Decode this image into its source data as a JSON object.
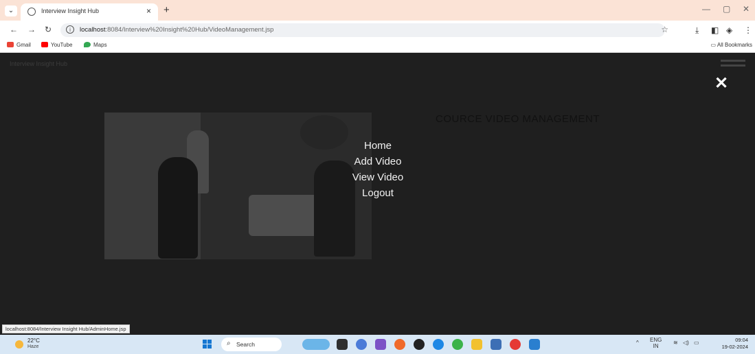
{
  "browser": {
    "tab_title": "Interview Insight Hub",
    "tab_close": "×",
    "new_tab": "+",
    "url_host": "localhost",
    "url_path": ":8084/Interview%20Insight%20Hub/VideoManagement.jsp",
    "window_minimize": "—",
    "window_restore": "▢",
    "window_close": "✕"
  },
  "bookmarks": [
    {
      "label": "Gmail",
      "color": "#ea4335"
    },
    {
      "label": "YouTube",
      "color": "#ff0000"
    },
    {
      "label": "Maps",
      "color": "#34a853"
    }
  ],
  "all_bookmarks": "All Bookmarks",
  "page": {
    "site_title": "Interview Insight Hub",
    "heading": "COURCE VIDEO MANAGEMENT",
    "close_symbol": "✕",
    "menu": [
      {
        "label": "Home"
      },
      {
        "label": "Add Video"
      },
      {
        "label": "View Video"
      },
      {
        "label": "Logout"
      }
    ]
  },
  "status_url": "localhost:8084/Interview Insight Hub/AdminHome.jsp",
  "taskbar": {
    "temperature": "22°C",
    "condition": "Haze",
    "search_label": "Search",
    "lang_top": "ENG",
    "lang_bottom": "IN",
    "time": "09:04",
    "date": "19-02-2024"
  },
  "colors": {
    "tabbar": "#fbe3d6",
    "overlay": "#1f1f1f",
    "taskbar": "#d8e7f5"
  }
}
